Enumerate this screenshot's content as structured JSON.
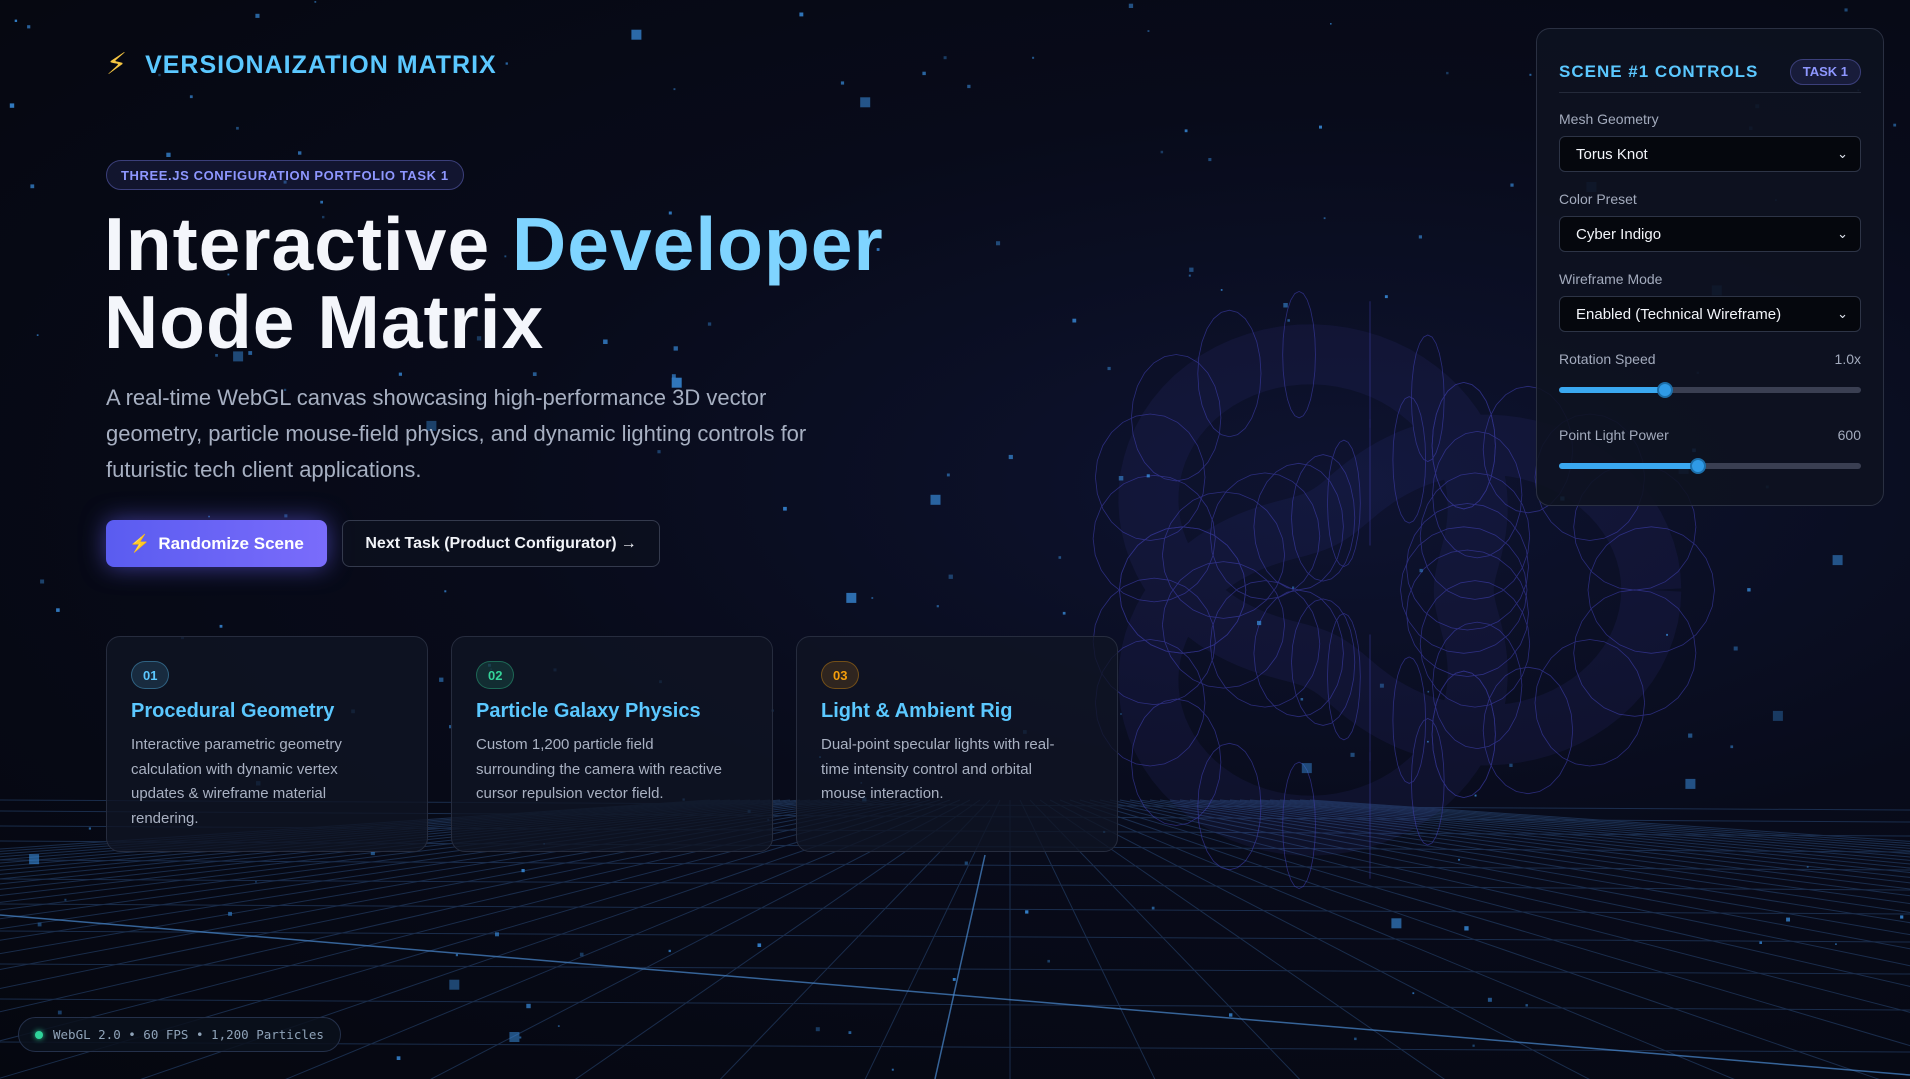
{
  "brand": {
    "icon": "lightning-bolt-icon",
    "name": "VERSIONAIZATION MATRIX"
  },
  "hero": {
    "tag": "THREE.JS CONFIGURATION PORTFOLIO TASK 1",
    "title_part1": "Interactive",
    "title_accent": "Developer",
    "title_line2": "Node Matrix",
    "description": "A real-time WebGL canvas showcasing high-performance 3D vector geometry, particle mouse-field physics, and dynamic lighting controls for futuristic tech client applications.",
    "primary_button": "Randomize Scene",
    "primary_button_icon": "lightning-bolt-icon",
    "secondary_button": "Next Task (Product Configurator)",
    "secondary_button_arrow": "→"
  },
  "features": [
    {
      "num": "01",
      "title": "Procedural Geometry",
      "desc": "Interactive parametric geometry calculation with dynamic vertex updates & wireframe material rendering.",
      "color": "#5bc8ff"
    },
    {
      "num": "02",
      "title": "Particle Galaxy Physics",
      "desc": "Custom 1,200 particle field surrounding the camera with reactive cursor repulsion vector field.",
      "color": "#34d399"
    },
    {
      "num": "03",
      "title": "Light & Ambient Rig",
      "desc": "Dual-point specular lights with real-time intensity control and orbital mouse interaction.",
      "color": "#f59e0b"
    }
  ],
  "panel": {
    "title": "SCENE #1 CONTROLS",
    "badge": "TASK 1",
    "mesh_label": "Mesh Geometry",
    "mesh_value": "Torus Knot",
    "color_label": "Color Preset",
    "color_value": "Cyber Indigo",
    "wire_label": "Wireframe Mode",
    "wire_value": "Enabled (Technical Wireframe)",
    "rotation_label": "Rotation Speed",
    "rotation_value": "1.0x",
    "rotation_fraction": 0.35,
    "light_label": "Point Light Power",
    "light_value": "600",
    "light_fraction": 0.46
  },
  "status": {
    "text": "WebGL 2.0 • 60 FPS • 1,200 Particles"
  },
  "colors": {
    "accent_cyan": "#5bc8ff",
    "accent_indigo": "#6c63ff",
    "background": "#070a16"
  }
}
